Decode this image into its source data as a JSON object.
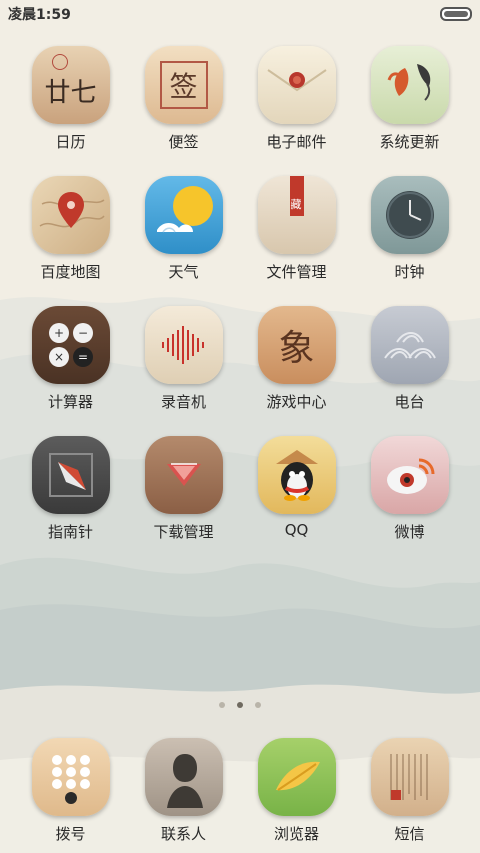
{
  "status": {
    "time": "凌晨1:59"
  },
  "apps": [
    {
      "label": "日历",
      "icon": "calendar-icon"
    },
    {
      "label": "便签",
      "icon": "notes-icon"
    },
    {
      "label": "电子邮件",
      "icon": "mail-icon"
    },
    {
      "label": "系统更新",
      "icon": "update-icon"
    },
    {
      "label": "百度地图",
      "icon": "map-icon"
    },
    {
      "label": "天气",
      "icon": "weather-icon"
    },
    {
      "label": "文件管理",
      "icon": "file-manager-icon"
    },
    {
      "label": "时钟",
      "icon": "clock-icon"
    },
    {
      "label": "计算器",
      "icon": "calculator-icon"
    },
    {
      "label": "录音机",
      "icon": "recorder-icon"
    },
    {
      "label": "游戏中心",
      "icon": "game-center-icon"
    },
    {
      "label": "电台",
      "icon": "radio-icon"
    },
    {
      "label": "指南针",
      "icon": "compass-icon"
    },
    {
      "label": "下载管理",
      "icon": "download-icon"
    },
    {
      "label": "QQ",
      "icon": "qq-icon"
    },
    {
      "label": "微博",
      "icon": "weibo-icon"
    }
  ],
  "dock": [
    {
      "label": "拨号",
      "icon": "dialer-icon"
    },
    {
      "label": "联系人",
      "icon": "contacts-icon"
    },
    {
      "label": "浏览器",
      "icon": "browser-icon"
    },
    {
      "label": "短信",
      "icon": "messages-icon"
    }
  ],
  "glyphs": {
    "calendar": "廿七",
    "notes": "签",
    "game": "象",
    "file_tag": "藏"
  },
  "pager": {
    "pages": 3,
    "active": 1
  }
}
